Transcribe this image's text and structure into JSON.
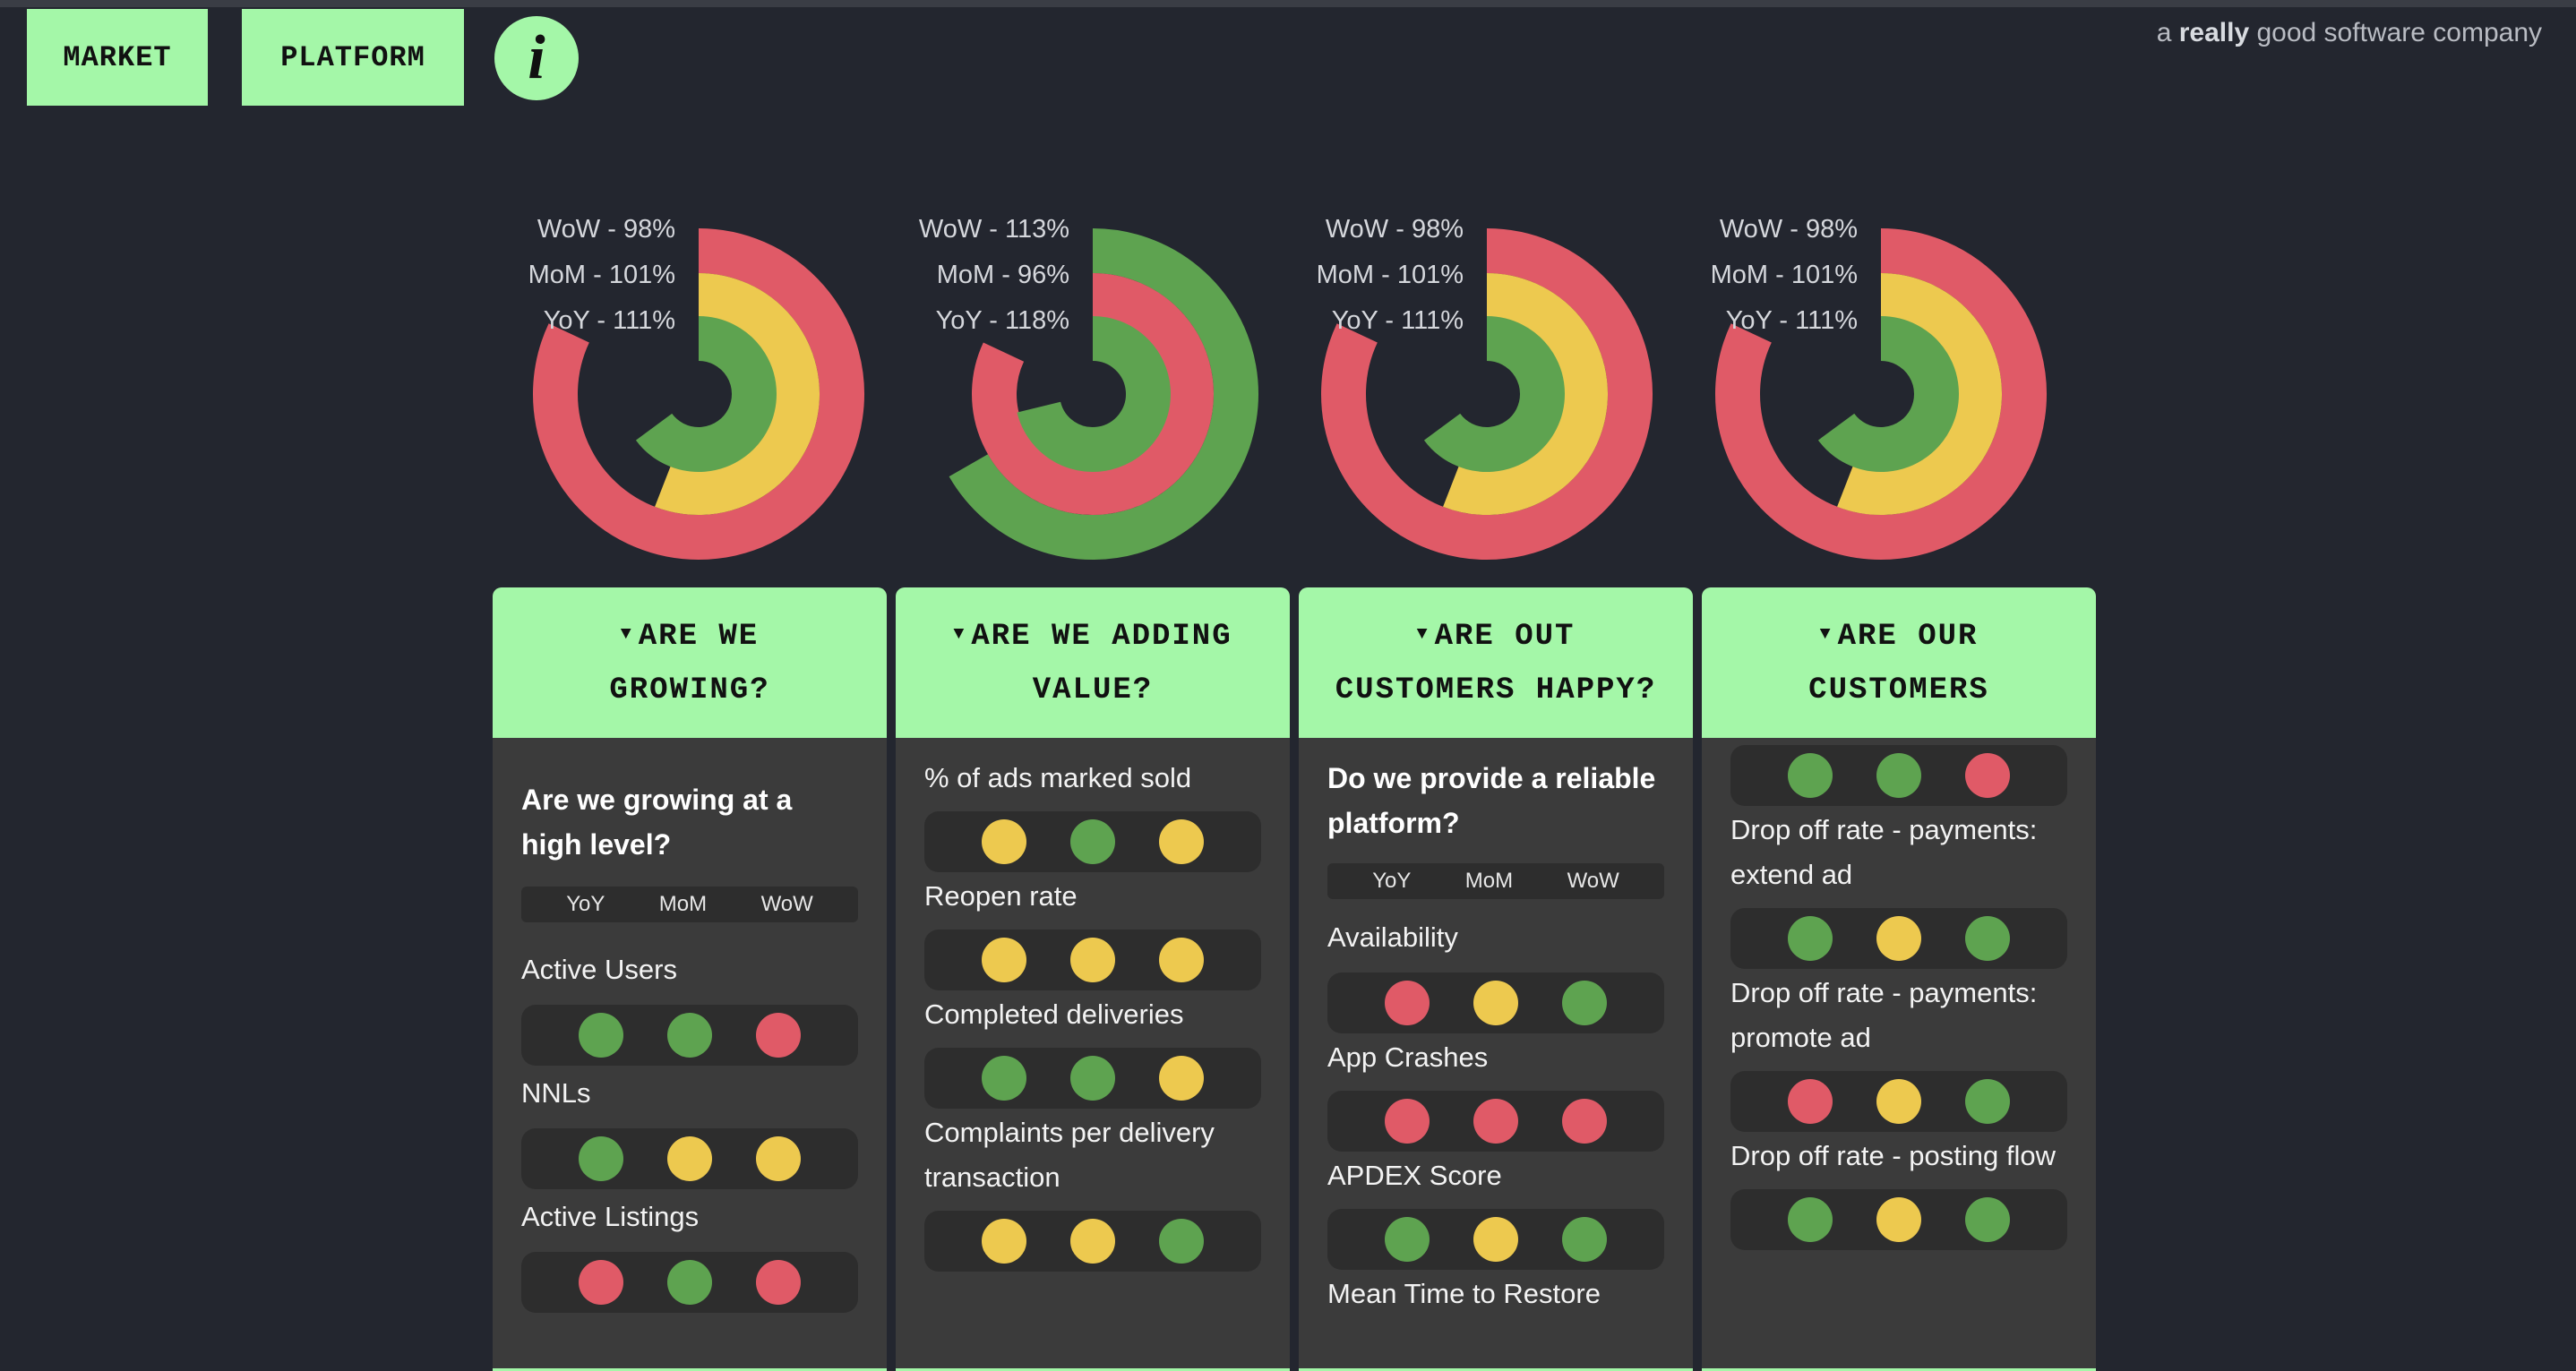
{
  "nav": {
    "market_label": "MARKET",
    "platform_label": "PLATFORM",
    "info_label": "i"
  },
  "tagline": {
    "prefix": "a",
    "emphasis": "really",
    "suffix": "good software company"
  },
  "colors": {
    "green": "#5ea350",
    "yellow": "#edc94f",
    "red": "#e05a67",
    "accent": "#a4f7a8",
    "background": "#23262f"
  },
  "radials": [
    {
      "labels": [
        {
          "prefix": "WoW - ",
          "value": "98%"
        },
        {
          "prefix": "MoM - ",
          "value": "101%"
        },
        {
          "prefix": "YoY - ",
          "value": "111%"
        }
      ],
      "rings": [
        {
          "name": "WoW",
          "pct": 98,
          "color": "red"
        },
        {
          "name": "MoM",
          "pct": 101,
          "color": "yellow"
        },
        {
          "name": "YoY",
          "pct": 111,
          "color": "green"
        }
      ]
    },
    {
      "labels": [
        {
          "prefix": "WoW - ",
          "value": "113%"
        },
        {
          "prefix": "MoM - ",
          "value": "96%"
        },
        {
          "prefix": "YoY - ",
          "value": "118%"
        }
      ],
      "rings": [
        {
          "name": "WoW",
          "pct": 113,
          "color": "green"
        },
        {
          "name": "MoM",
          "pct": 96,
          "color": "red"
        },
        {
          "name": "YoY",
          "pct": 118,
          "color": "green"
        }
      ]
    },
    {
      "labels": [
        {
          "prefix": "WoW - ",
          "value": "98%"
        },
        {
          "prefix": "MoM - ",
          "value": "101%"
        },
        {
          "prefix": "YoY - ",
          "value": "111%"
        }
      ],
      "rings": [
        {
          "name": "WoW",
          "pct": 98,
          "color": "red"
        },
        {
          "name": "MoM",
          "pct": 101,
          "color": "yellow"
        },
        {
          "name": "YoY",
          "pct": 111,
          "color": "green"
        }
      ]
    },
    {
      "labels": [
        {
          "prefix": "WoW - ",
          "value": "98%"
        },
        {
          "prefix": "MoM - ",
          "value": "101%"
        },
        {
          "prefix": "YoY - ",
          "value": "111%"
        }
      ],
      "rings": [
        {
          "name": "WoW",
          "pct": 98,
          "color": "red"
        },
        {
          "name": "MoM",
          "pct": 101,
          "color": "yellow"
        },
        {
          "name": "YoY",
          "pct": 111,
          "color": "green"
        }
      ]
    }
  ],
  "cards": [
    {
      "header": [
        "ARE WE",
        "GROWING?"
      ],
      "question": "Are we growing at a high level?",
      "legend": [
        "YoY",
        "MoM",
        "WoW"
      ],
      "metrics": [
        {
          "label": "Active Users",
          "dots": [
            "green",
            "green",
            "red"
          ]
        },
        {
          "label": "NNLs",
          "dots": [
            "green",
            "yellow",
            "yellow"
          ]
        },
        {
          "label": "Active Listings",
          "dots": [
            "red",
            "green",
            "red"
          ]
        }
      ]
    },
    {
      "header": [
        "ARE WE ADDING",
        "VALUE?"
      ],
      "lead_metric": "% of ads marked sold",
      "metrics": [
        {
          "dots": [
            "yellow",
            "green",
            "yellow"
          ],
          "label": "Reopen rate"
        },
        {
          "dots": [
            "yellow",
            "yellow",
            "yellow"
          ],
          "label": "Completed deliveries"
        },
        {
          "dots": [
            "green",
            "green",
            "yellow"
          ],
          "label": "Complaints per delivery transaction"
        },
        {
          "dots": [
            "yellow",
            "yellow",
            "green"
          ]
        }
      ]
    },
    {
      "header": [
        "ARE OUT",
        "CUSTOMERS HAPPY?"
      ],
      "question": "Do we provide a reliable platform?",
      "legend": [
        "YoY",
        "MoM",
        "WoW"
      ],
      "metrics": [
        {
          "label": "Availability",
          "dots": [
            "red",
            "yellow",
            "green"
          ]
        },
        {
          "label": "App Crashes",
          "dots": [
            "red",
            "red",
            "red"
          ]
        },
        {
          "label": "APDEX Score",
          "dots": [
            "green",
            "yellow",
            "green"
          ]
        },
        {
          "label": "Mean Time to Restore"
        }
      ]
    },
    {
      "header": [
        "ARE OUR",
        "CUSTOMERS"
      ],
      "metrics": [
        {
          "dots": [
            "green",
            "green",
            "red"
          ],
          "label": "Drop off rate - payments: extend ad"
        },
        {
          "dots": [
            "green",
            "yellow",
            "green"
          ],
          "label": "Drop off rate - payments: promote ad"
        },
        {
          "dots": [
            "red",
            "yellow",
            "green"
          ],
          "label": "Drop off rate - posting flow"
        },
        {
          "dots": [
            "green",
            "yellow",
            "green"
          ]
        }
      ]
    }
  ]
}
